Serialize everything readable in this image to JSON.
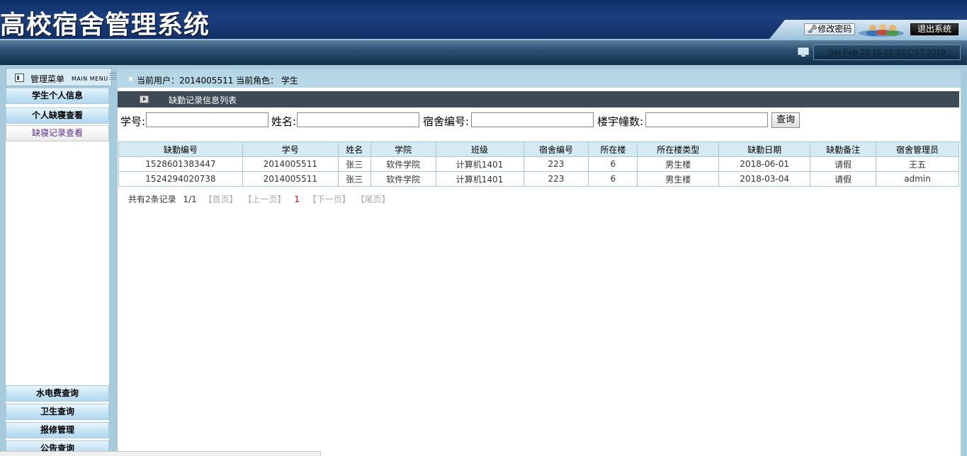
{
  "header": {
    "system_title": "高校宿舍管理系统",
    "change_password_label": "修改密码",
    "logout_label": "退出系统",
    "datetime": "Sat Feb 23 15:01:33 CST 2019"
  },
  "menu": {
    "title": "管理菜单",
    "subtitle": "MAIN MENU"
  },
  "userbar": {
    "text": "当前用户：2014005511   当前角色： 学生"
  },
  "sidebar": {
    "items": [
      {
        "label": "学生个人信息"
      },
      {
        "label": "个人缺寝查看"
      },
      {
        "label": "缺寝记录查看"
      },
      {
        "label": "水电费查询"
      },
      {
        "label": "卫生查询"
      },
      {
        "label": "报修管理"
      },
      {
        "label": "公告查询"
      }
    ]
  },
  "main": {
    "list_title": "缺勤记录信息列表",
    "search": {
      "student_no_label": "学号:",
      "name_label": "姓名:",
      "dorm_no_label": "宿舍编号:",
      "building_label": "楼宇幢数:",
      "student_no_value": "",
      "name_value": "",
      "dorm_no_value": "",
      "building_value": "",
      "query_label": "查询"
    },
    "table": {
      "headers": [
        "缺勤编号",
        "学号",
        "姓名",
        "学院",
        "班级",
        "宿舍编号",
        "所在楼",
        "所在楼类型",
        "缺勤日期",
        "缺勤备注",
        "宿舍管理员"
      ],
      "rows": [
        [
          "1528601383447",
          "2014005511",
          "张三",
          "软件学院",
          "计算机1401",
          "223",
          "6",
          "男生楼",
          "2018-06-01",
          "请假",
          "王五"
        ],
        [
          "1524294020738",
          "2014005511",
          "张三",
          "软件学院",
          "计算机1401",
          "223",
          "6",
          "男生楼",
          "2018-03-04",
          "请假",
          "admin"
        ]
      ]
    },
    "pager": {
      "total": "共有2条记录",
      "pages": "1/1",
      "first": "【首页】",
      "prev": "【上一页】",
      "current": "1",
      "next": "【下一页】",
      "last": "【尾页】"
    }
  },
  "colors": {
    "header_bg": "#1d3f7e",
    "frame_bg": "#a7cbdc",
    "list_head_bg": "#3e4a55",
    "table_head_bg": "#d5eaf2",
    "pager_current": "#cc0000"
  }
}
